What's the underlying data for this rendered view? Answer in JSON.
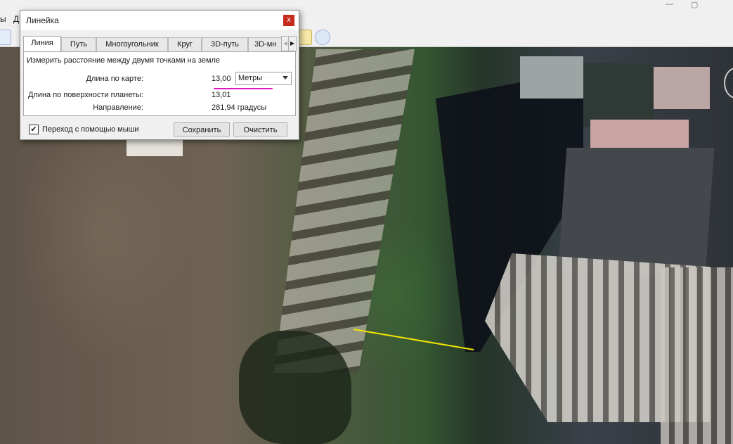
{
  "app": {
    "menu_partial": "ы",
    "menu_partial2": "Д"
  },
  "dialog": {
    "title": "Линейка",
    "close_label": "x",
    "tabs": [
      {
        "label": "Линия",
        "active": true
      },
      {
        "label": "Путь",
        "active": false
      },
      {
        "label": "Многоугольник",
        "active": false
      },
      {
        "label": "Круг",
        "active": false
      },
      {
        "label": "3D-путь",
        "active": false
      },
      {
        "label": "3D-мн",
        "active": false
      }
    ],
    "tab_scroll_left": "◀",
    "tab_scroll_right": "▶",
    "description": "Измерить расстояние между двумя точками на земле",
    "map_length_label": "Длина по карте:",
    "map_length_value": "13,00",
    "units_selected": "Метры",
    "surface_length_label": "Длина по поверхности планеты:",
    "surface_length_value": "13,01",
    "heading_label": "Направление:",
    "heading_value": "281,94 градусы",
    "mouse_nav_label": "Переход с помощью мыши",
    "mouse_nav_checked": "✔",
    "save_label": "Сохранить",
    "clear_label": "Очистить"
  },
  "colors": {
    "measure_line": "#f5e600",
    "highlight": "#e01bc4"
  }
}
